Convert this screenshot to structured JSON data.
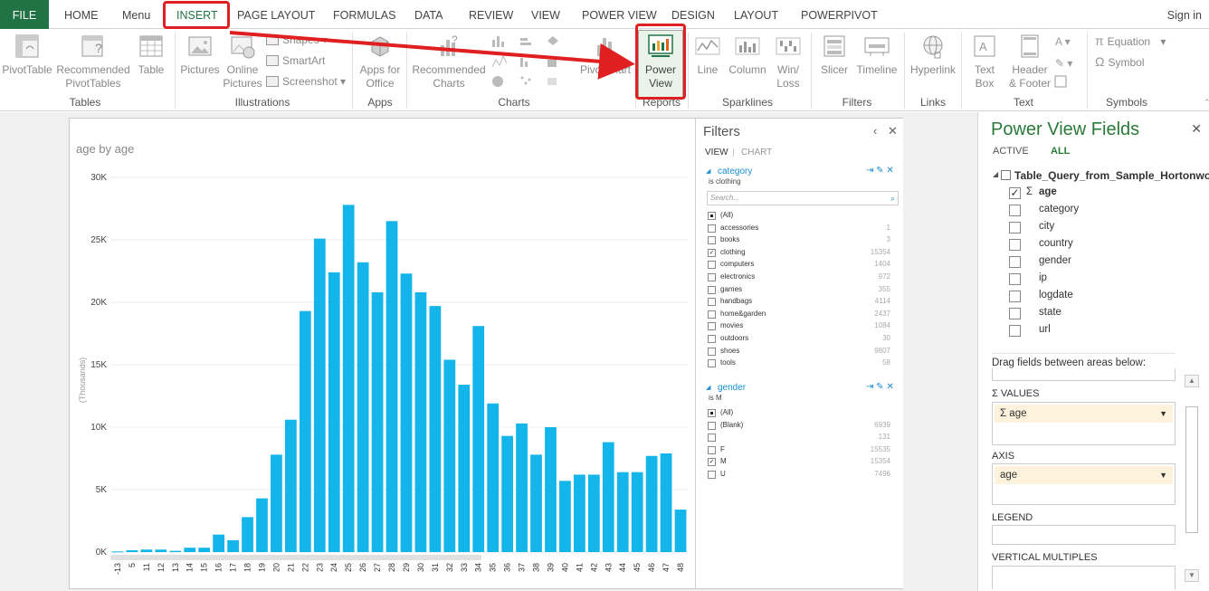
{
  "ribbon": {
    "file_tab": "FILE",
    "tabs": [
      "HOME",
      "Menu",
      "INSERT",
      "PAGE LAYOUT",
      "FORMULAS",
      "DATA",
      "REVIEW",
      "VIEW",
      "POWER VIEW",
      "DESIGN",
      "LAYOUT",
      "POWERPIVOT"
    ],
    "sign_in": "Sign in",
    "groups": {
      "tables": {
        "label": "Tables",
        "pivottable": "PivotTable",
        "recommended_line1": "Recommended",
        "recommended_line2": "PivotTables",
        "table": "Table"
      },
      "illustrations": {
        "label": "Illustrations",
        "pictures": "Pictures",
        "online_line1": "Online",
        "online_line2": "Pictures",
        "shapes": "Shapes",
        "smartart": "SmartArt",
        "screenshot": "Screenshot"
      },
      "apps": {
        "label": "Apps",
        "line1": "Apps for",
        "line2": "Office"
      },
      "charts": {
        "label": "Charts",
        "recommended_line1": "Recommended",
        "recommended_line2": "Charts",
        "pivotchart": "PivotChart"
      },
      "reports": {
        "label": "Reports",
        "power_line1": "Power",
        "power_line2": "View"
      },
      "sparklines": {
        "label": "Sparklines",
        "line": "Line",
        "column": "Column",
        "winloss_line1": "Win/",
        "winloss_line2": "Loss"
      },
      "filters": {
        "label": "Filters",
        "slicer": "Slicer",
        "timeline": "Timeline"
      },
      "links": {
        "label": "Links",
        "hyperlink": "Hyperlink"
      },
      "text": {
        "label": "Text",
        "textbox_line1": "Text",
        "textbox_line2": "Box",
        "header_line1": "Header",
        "header_line2": "& Footer"
      },
      "symbols": {
        "label": "Symbols",
        "equation": "Equation",
        "symbol": "Symbol"
      }
    }
  },
  "colors": {
    "accent_green": "#217346",
    "bar_blue": "#13b5ea",
    "callout_red": "#e02020",
    "filter_blue": "#1a8fd0"
  },
  "chart_data": {
    "type": "bar",
    "title": "age by age",
    "ylabel": "(Thousands)",
    "ylim": [
      0,
      30000
    ],
    "yticks": [
      0,
      5000,
      10000,
      15000,
      20000,
      25000,
      30000
    ],
    "ytick_labels": [
      "0K",
      "5K",
      "10K",
      "15K",
      "20K",
      "25K",
      "30K"
    ],
    "categories": [
      "-13",
      "5",
      "11",
      "12",
      "13",
      "14",
      "15",
      "16",
      "17",
      "18",
      "19",
      "20",
      "21",
      "22",
      "23",
      "24",
      "25",
      "26",
      "27",
      "28",
      "29",
      "30",
      "31",
      "32",
      "33",
      "34",
      "35",
      "36",
      "37",
      "38",
      "39",
      "40",
      "41",
      "42",
      "43",
      "44",
      "45",
      "46",
      "47",
      "48"
    ],
    "values": [
      50,
      150,
      200,
      200,
      100,
      350,
      350,
      1400,
      950,
      2800,
      4300,
      7800,
      10600,
      19300,
      25100,
      22400,
      27800,
      23200,
      20800,
      26500,
      22300,
      20800,
      19700,
      15400,
      13400,
      18100,
      11900,
      9300,
      10300,
      7800,
      10000,
      5700,
      6200,
      6200,
      8800,
      6400,
      6400,
      7700,
      7900,
      3400
    ],
    "grid": true
  },
  "filters_pane": {
    "title": "Filters",
    "tab_view": "VIEW",
    "tab_sep": "|",
    "tab_chart": "CHART",
    "collapse_glyph": "‹",
    "close_glyph": "✕",
    "category": {
      "title": "category",
      "subtitle": "is clothing",
      "search_placeholder": "Search...",
      "items": [
        {
          "label": "(All)",
          "count": "",
          "state": "all"
        },
        {
          "label": "accessories",
          "count": "1",
          "state": ""
        },
        {
          "label": "books",
          "count": "3",
          "state": ""
        },
        {
          "label": "clothing",
          "count": "15354",
          "state": "✓"
        },
        {
          "label": "computers",
          "count": "1404",
          "state": ""
        },
        {
          "label": "electronics",
          "count": "972",
          "state": ""
        },
        {
          "label": "games",
          "count": "355",
          "state": ""
        },
        {
          "label": "handbags",
          "count": "4114",
          "state": ""
        },
        {
          "label": "home&garden",
          "count": "2437",
          "state": ""
        },
        {
          "label": "movies",
          "count": "1084",
          "state": ""
        },
        {
          "label": "outdoors",
          "count": "30",
          "state": ""
        },
        {
          "label": "shoes",
          "count": "9807",
          "state": ""
        },
        {
          "label": "tools",
          "count": "58",
          "state": ""
        }
      ]
    },
    "gender": {
      "title": "gender",
      "subtitle": "is M",
      "items": [
        {
          "label": "(All)",
          "count": "",
          "state": "all"
        },
        {
          "label": "(Blank)",
          "count": "6939",
          "state": ""
        },
        {
          "label": "",
          "count": "131",
          "state": ""
        },
        {
          "label": "F",
          "count": "15535",
          "state": ""
        },
        {
          "label": "M",
          "count": "15354",
          "state": "✓"
        },
        {
          "label": "U",
          "count": "7496",
          "state": ""
        }
      ]
    }
  },
  "fields_pane": {
    "title": "Power View Fields",
    "close_glyph": "✕",
    "tab_active": "ACTIVE",
    "tab_all": "ALL",
    "table_name": "Table_Query_from_Sample_Hortonworks",
    "fields": [
      {
        "name": "age",
        "checked": "✓",
        "sigma": "Σ",
        "bold": true
      },
      {
        "name": "category",
        "checked": "",
        "sigma": "",
        "bold": false
      },
      {
        "name": "city",
        "checked": "",
        "sigma": "",
        "bold": false
      },
      {
        "name": "country",
        "checked": "",
        "sigma": "",
        "bold": false
      },
      {
        "name": "gender",
        "checked": "",
        "sigma": "",
        "bold": false
      },
      {
        "name": "ip",
        "checked": "",
        "sigma": "",
        "bold": false
      },
      {
        "name": "logdate",
        "checked": "",
        "sigma": "",
        "bold": false
      },
      {
        "name": "state",
        "checked": "",
        "sigma": "",
        "bold": false
      },
      {
        "name": "url",
        "checked": "",
        "sigma": "",
        "bold": false
      }
    ],
    "drag_hint": "Drag fields between areas below:",
    "values_label": "Σ VALUES",
    "values_field": "Σ age",
    "axis_label": "AXIS",
    "axis_field": "age",
    "legend_label": "LEGEND",
    "vertical_multiples_label": "VERTICAL MULTIPLES"
  }
}
